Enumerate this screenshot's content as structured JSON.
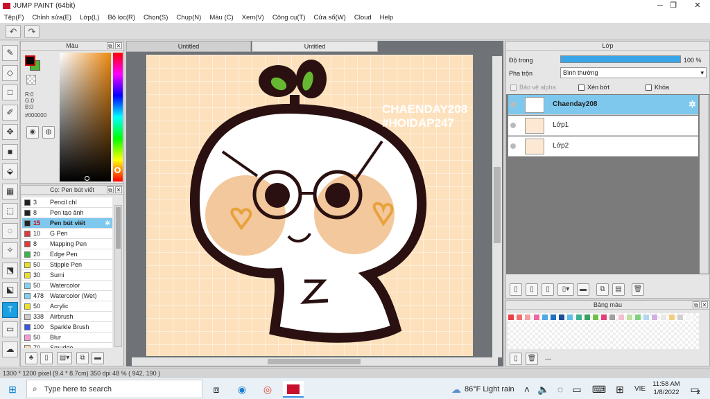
{
  "window": {
    "title": "JUMP PAINT (64bit)",
    "controls": {
      "minimize": "─",
      "maximize": "❐",
      "close": "✕"
    }
  },
  "menu": [
    "Tệp(F)",
    "Chỉnh sửa(E)",
    "Lớp(L)",
    "Bộ lọc(R)",
    "Chọn(S)",
    "Chụp(N)",
    "Màu (C)",
    "Xem(V)",
    "Công cụ(T)",
    "Cửa sổ(W)",
    "Cloud",
    "Help"
  ],
  "toolbar": {
    "undo": "↶",
    "redo": "↷"
  },
  "tools": [
    {
      "id": "brush",
      "glyph": "✎"
    },
    {
      "id": "eraser",
      "glyph": "◇"
    },
    {
      "id": "select-rect",
      "glyph": "□"
    },
    {
      "id": "select-pen",
      "glyph": "✐"
    },
    {
      "id": "move",
      "glyph": "✥"
    },
    {
      "id": "fill-rect",
      "glyph": "■"
    },
    {
      "id": "bucket",
      "glyph": "⬙"
    },
    {
      "id": "gradient",
      "glyph": "▦"
    },
    {
      "id": "marquee",
      "glyph": "⬚"
    },
    {
      "id": "lasso",
      "glyph": "◌"
    },
    {
      "id": "magic-wand",
      "glyph": "✧"
    },
    {
      "id": "select-brush",
      "glyph": "⬔"
    },
    {
      "id": "select-eraser",
      "glyph": "⬕"
    },
    {
      "id": "text",
      "glyph": "T"
    },
    {
      "id": "divider",
      "glyph": "▭"
    },
    {
      "id": "cloud",
      "glyph": "☁"
    }
  ],
  "color_panel": {
    "title": "Màu",
    "rgb": {
      "r": "R:0",
      "g": "G:0",
      "b": "B:0"
    },
    "hex": "#000000",
    "fg": "#000000",
    "bg": "#53b43b"
  },
  "brush_panel": {
    "title": "Cọ: Pen bút viết",
    "brushes": [
      {
        "size": "3",
        "name": "Pencil chì",
        "color": "#222222"
      },
      {
        "size": "8",
        "name": "Pen tạo ảnh",
        "color": "#222222"
      },
      {
        "size": "15",
        "name": "Pen bút viết",
        "color": "#222222",
        "selected": true
      },
      {
        "size": "10",
        "name": "G Pen",
        "color": "#e03a3a"
      },
      {
        "size": "8",
        "name": "Mapping Pen",
        "color": "#e03a3a"
      },
      {
        "size": "20",
        "name": "Edge Pen",
        "color": "#3ab54a"
      },
      {
        "size": "50",
        "name": "Stipple Pen",
        "color": "#e8e02a"
      },
      {
        "size": "30",
        "name": "Sumi",
        "color": "#e8e02a"
      },
      {
        "size": "50",
        "name": "Watercolor",
        "color": "#7ed3f0"
      },
      {
        "size": "478",
        "name": "Watercolor (Wet)",
        "color": "#7ed3f0"
      },
      {
        "size": "50",
        "name": "Acrylic",
        "color": "#e8e02a"
      },
      {
        "size": "338",
        "name": "Airbrush",
        "color": "#cccccc"
      },
      {
        "size": "100",
        "name": "Sparkle Brush",
        "color": "#3a58e0"
      },
      {
        "size": "50",
        "name": "Blur",
        "color": "#f59ad8"
      },
      {
        "size": "70",
        "name": "Smudge",
        "color": "#fadcb0"
      }
    ]
  },
  "tabs": [
    {
      "label": "Untitled",
      "active": false
    },
    {
      "label": "Untitled",
      "active": true
    }
  ],
  "canvas": {
    "bg_color": "#fde1bd",
    "watermark1": "CHAENDAY208",
    "watermark2": "#HOIDAP247"
  },
  "layer_panel": {
    "title": "Lớp",
    "opacity_label": "Độ trong",
    "opacity_value": "100 %",
    "opacity_fraction": 1.0,
    "blend_label": "Pha trộn",
    "blend_value": "Bình thường",
    "protect_alpha": "Bảo vệ alpha",
    "clipping": "Xén bớt",
    "lock": "Khóa",
    "layers": [
      {
        "name": "Chaenday208",
        "selected": true
      },
      {
        "name": "Lớp1",
        "selected": false
      },
      {
        "name": "Lớp2",
        "selected": false
      }
    ]
  },
  "swatch_panel": {
    "title": "Bảng màu",
    "footer": "---",
    "colors": [
      "#e8404a",
      "#f07070",
      "#f5a0a0",
      "#e86aa0",
      "#50a8e0",
      "#2070c0",
      "#1a4f98",
      "#5cc0e8",
      "#40b090",
      "#3aa060",
      "#70c050",
      "#e0407a",
      "#a0a0a0",
      "#f0c0d0",
      "#c0e0a0",
      "#80d080",
      "#b0d8f0",
      "#d0b0e0",
      "#e8e8e8",
      "#f0d080",
      "#d0d0d0",
      "#f5f5f5"
    ]
  },
  "status": {
    "text": "1300 * 1200 pixel   (9.4 * 8.7cm)   350 dpi   48 %   ( 942, 190 )"
  },
  "taskbar": {
    "search_placeholder": "Type here to search",
    "weather": "86°F  Light rain",
    "lang": "VIE",
    "time": "11:58 AM",
    "date": "1/8/2022",
    "notification_count": "2"
  }
}
